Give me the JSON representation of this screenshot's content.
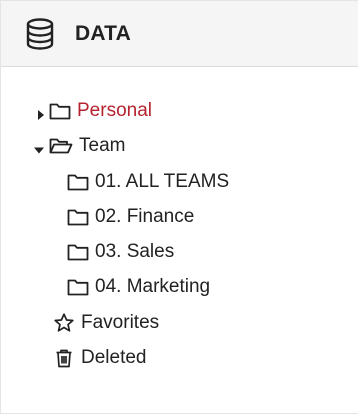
{
  "panel": {
    "title": "DATA",
    "header_icon": "database-icon"
  },
  "tree": {
    "personal": {
      "label": "Personal",
      "icon": "folder-icon",
      "expanded": false,
      "selected": true
    },
    "team": {
      "label": "Team",
      "icon": "folder-open-icon",
      "expanded": true
    },
    "team_children": [
      {
        "label": "01. ALL TEAMS",
        "icon": "folder-icon"
      },
      {
        "label": "02. Finance",
        "icon": "folder-icon"
      },
      {
        "label": "03. Sales",
        "icon": "folder-icon"
      },
      {
        "label": "04. Marketing",
        "icon": "folder-icon"
      }
    ],
    "favorites": {
      "label": "Favorites",
      "icon": "star-icon"
    },
    "deleted": {
      "label": "Deleted",
      "icon": "trash-icon"
    }
  },
  "colors": {
    "selected_text": "#b5232f",
    "header_bg": "#f5f5f5"
  }
}
